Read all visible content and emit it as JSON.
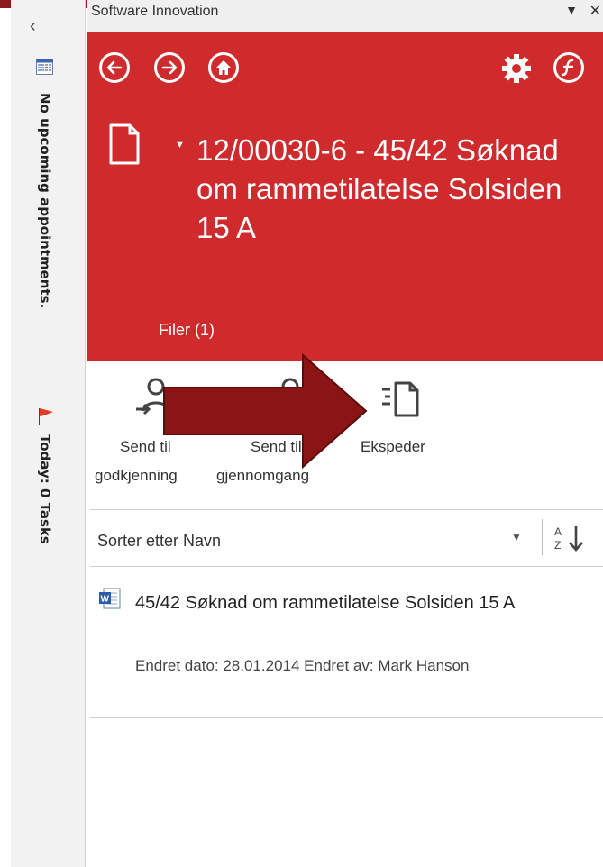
{
  "todo_bar": {
    "collapse_glyph": "‹",
    "appointments_text": "No upcoming appointments.",
    "tasks_text": "Today: 0 Tasks"
  },
  "pane": {
    "title": "Software Innovation",
    "menu_glyph": "▼",
    "close_glyph": "✕"
  },
  "header": {
    "back_icon": "back-circle-icon",
    "forward_icon": "forward-circle-icon",
    "home_icon": "home-circle-icon",
    "settings_icon": "gear-icon",
    "logo_icon": "f-logo-icon",
    "document_title": "12/00030-6 - 45/42 Søknad om rammetilatelse Solsiden 15 A",
    "files_label": "Filer (1)",
    "accent_color": "#cf2a2c"
  },
  "actions": [
    {
      "label_line1": "Send til",
      "label_line2": "godkjenning",
      "icon": "send-approval-icon"
    },
    {
      "label_line1": "Send til",
      "label_line2": "gjennomgang",
      "icon": "send-review-icon"
    },
    {
      "label_line1": "Ekspeder",
      "label_line2": "",
      "icon": "dispatch-icon"
    }
  ],
  "sort": {
    "label": "Sorter etter Navn",
    "caret": "▼"
  },
  "files": [
    {
      "name": "45/42 Søknad om rammetilatelse Solsiden 15 A",
      "meta": "Endret dato: 28.01.2014 Endret av: Mark Hanson",
      "icon": "word-document-icon"
    }
  ],
  "overlay": {
    "arrow_color": "#8b1414"
  }
}
